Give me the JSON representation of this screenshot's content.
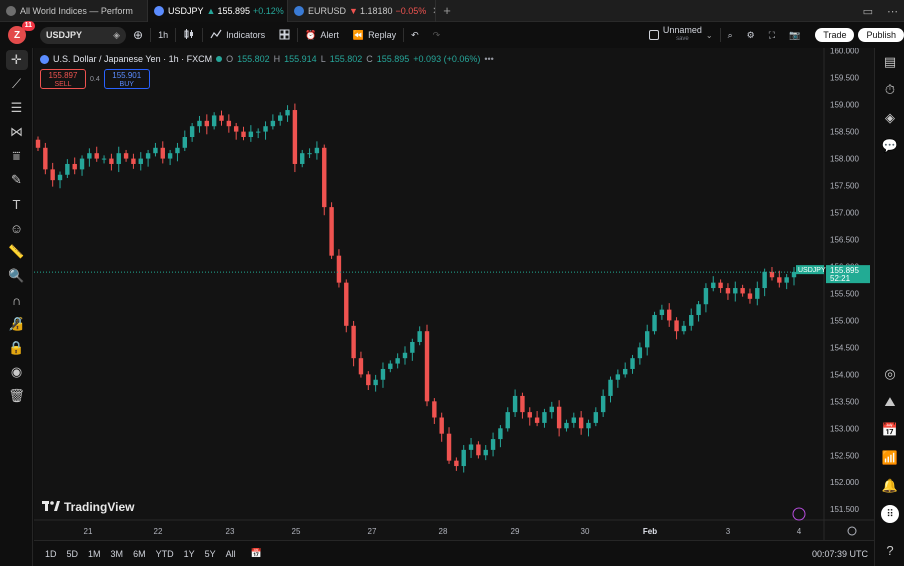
{
  "browser_tabs": [
    {
      "title": "All World Indices — Perform",
      "color": "#7a7a7a",
      "active": false
    },
    {
      "title": "USDJPY",
      "price": "155.895",
      "change": "+0.12%",
      "direction": "up",
      "color": "#5b8cff",
      "active": true
    },
    {
      "title": "EURUSD",
      "price": "1.18180",
      "change": "−0.05%",
      "direction": "down",
      "color": "#3a7bd5",
      "active": false
    }
  ],
  "toolbar": {
    "avatar_letter": "Z",
    "notif_count": "11",
    "symbol": "USDJPY",
    "interval": "1h",
    "indicators_label": "Indicators",
    "alert_label": "Alert",
    "replay_label": "Replay",
    "layout_name": "Unnamed",
    "save_label": "save",
    "trade_label": "Trade",
    "publish_label": "Publish"
  },
  "legend": {
    "title": "U.S. Dollar / Japanese Yen · 1h · FXCM",
    "o_label": "O",
    "o_value": "155.802",
    "h_label": "H",
    "h_value": "155.914",
    "l_label": "L",
    "l_value": "155.802",
    "c_label": "C",
    "c_value": "155.895",
    "change": "+0.093 (+0.06%)",
    "more": "•••"
  },
  "trade_buttons": {
    "sell_price": "155.897",
    "sell_label": "SELL",
    "spread": "0.4",
    "buy_price": "155.901",
    "buy_label": "BUY"
  },
  "price_tag": {
    "symbol": "USDJPY",
    "price": "155.895",
    "countdown": "52:21",
    "color": "#22ab94"
  },
  "watermark": "TradingView",
  "timeframes": [
    "1D",
    "5D",
    "1M",
    "3M",
    "6M",
    "YTD",
    "1Y",
    "5Y",
    "All"
  ],
  "clock": "00:07:39 UTC",
  "colors": {
    "up": "#26a69a",
    "down": "#ef5350",
    "background": "#131313"
  },
  "left_tools": [
    "crosshair-icon",
    "trend-line-icon",
    "fib-icon",
    "pattern-icon",
    "projection-icon",
    "brush-icon",
    "text-icon",
    "emoji-icon",
    "ruler-icon",
    "zoom-icon",
    "magnet-icon",
    "lock-draw-icon",
    "lock-icon",
    "eye-icon",
    "trash-icon"
  ],
  "right_tools": [
    "watchlist-icon",
    "alerts-icon",
    "layers-icon",
    "chat-icon",
    "target-icon",
    "ideas-icon",
    "calendar-icon",
    "broadcast-icon",
    "bell-icon",
    "apps-icon",
    "help-icon"
  ],
  "chart_data": {
    "type": "candlestick",
    "symbol": "USDJPY",
    "interval": "1h",
    "x_ticks": [
      "21",
      "22",
      "23",
      "24",
      "25",
      "27",
      "28",
      "29",
      "30",
      "Feb",
      "3",
      "4"
    ],
    "y_ticks": [
      160.0,
      159.5,
      159.0,
      158.5,
      158.0,
      157.5,
      157.0,
      156.5,
      156.0,
      155.5,
      155.0,
      154.5,
      154.0,
      153.5,
      153.0,
      152.5,
      152.0,
      151.5
    ],
    "ylim": [
      151.3,
      160.05
    ],
    "last_price": 155.895,
    "closes": [
      158.2,
      157.8,
      157.6,
      157.7,
      157.9,
      157.8,
      158.0,
      158.1,
      158.0,
      158.0,
      157.9,
      158.1,
      158.0,
      157.9,
      158.0,
      158.1,
      158.2,
      158.0,
      158.1,
      158.2,
      158.4,
      158.6,
      158.7,
      158.6,
      158.8,
      158.7,
      158.6,
      158.5,
      158.4,
      158.5,
      158.5,
      158.6,
      158.7,
      158.8,
      158.9,
      157.9,
      158.1,
      158.1,
      158.2,
      157.1,
      156.2,
      155.7,
      154.9,
      154.3,
      154.0,
      153.8,
      153.9,
      154.1,
      154.2,
      154.3,
      154.4,
      154.6,
      154.8,
      153.5,
      153.2,
      152.9,
      152.4,
      152.3,
      152.6,
      152.7,
      152.5,
      152.6,
      152.8,
      153.0,
      153.3,
      153.6,
      153.3,
      153.2,
      153.1,
      153.3,
      153.4,
      153.0,
      153.1,
      153.2,
      153.0,
      153.1,
      153.3,
      153.6,
      153.9,
      154.0,
      154.1,
      154.3,
      154.5,
      154.8,
      155.1,
      155.2,
      155.0,
      154.8,
      154.9,
      155.1,
      155.3,
      155.6,
      155.7,
      155.6,
      155.5,
      155.6,
      155.5,
      155.4,
      155.6,
      155.9,
      155.8,
      155.7,
      155.8,
      155.9
    ]
  }
}
